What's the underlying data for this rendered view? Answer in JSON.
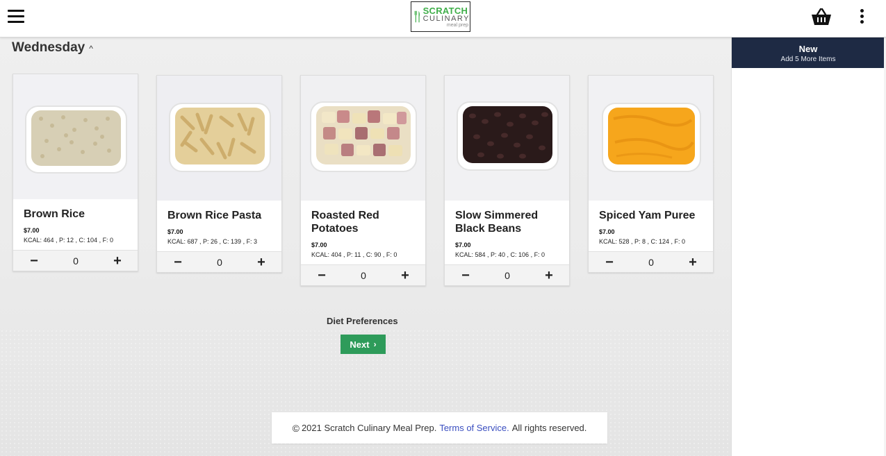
{
  "header": {
    "logo": {
      "line1": "SCRATCH",
      "line2": "CULINARY",
      "line3": "meal prep"
    },
    "menu_icon": "hamburger-icon",
    "cart_icon": "basket-icon",
    "more_icon": "kebab-icon"
  },
  "day": {
    "title": "Wednesday",
    "chevron": "^"
  },
  "products": [
    {
      "name": "Brown Rice",
      "price": "$7.00",
      "macros": "KCAL: 464 , P: 12 , C: 104 , F: 0",
      "qty": "0",
      "minus": "−",
      "plus": "+"
    },
    {
      "name": "Brown Rice Pasta",
      "price": "$7.00",
      "macros": "KCAL: 687 , P: 26 , C: 139 , F: 3",
      "qty": "0",
      "minus": "−",
      "plus": "+"
    },
    {
      "name": "Roasted Red Potatoes",
      "price": "$7.00",
      "macros": "KCAL: 404 , P: 11 , C: 90 , F: 0",
      "qty": "0",
      "minus": "−",
      "plus": "+"
    },
    {
      "name": "Slow Simmered Black Beans",
      "price": "$7.00",
      "macros": "KCAL: 584 , P: 40 , C: 106 , F: 0",
      "qty": "0",
      "minus": "−",
      "plus": "+"
    },
    {
      "name": "Spiced Yam Puree",
      "price": "$7.00",
      "macros": "KCAL: 528 , P: 8 , C: 124 , F: 0",
      "qty": "0",
      "minus": "−",
      "plus": "+"
    }
  ],
  "diet": {
    "label": "Diet Preferences",
    "next": "Next",
    "next_arrow": "›"
  },
  "footer": {
    "copy_symbol": "©",
    "text": "2021 Scratch Culinary Meal Prep.",
    "terms": "Terms of Service.",
    "rights": "All rights reserved."
  },
  "sidebar": {
    "title": "New",
    "subtitle": "Add 5 More Items"
  },
  "colors": {
    "accent": "#2e9b5a",
    "sidebar_header": "#1e2a44",
    "link": "#3a4ec0",
    "logo_green": "#3fae49"
  }
}
